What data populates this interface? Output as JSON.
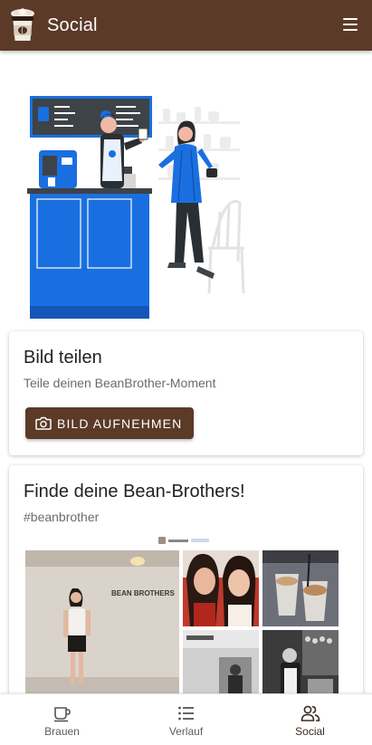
{
  "appbar": {
    "title": "Social",
    "logo_icon": "coffee-cup-logo-icon",
    "menu_icon": "hamburger-menu-icon"
  },
  "share_card": {
    "title": "Bild teilen",
    "subtitle": "Teile deinen BeanBrother-Moment",
    "button_label": "BILD AUFNEHMEN",
    "button_icon": "camera-icon"
  },
  "community_card": {
    "title": "Finde deine Bean-Brothers!",
    "hashtag": "#beanbrother",
    "wall_sign": "BEAN BROTHERS"
  },
  "bottom_nav": {
    "items": [
      {
        "label": "Brauen",
        "icon": "coffee-cup-icon",
        "active": false
      },
      {
        "label": "Verlauf",
        "icon": "list-icon",
        "active": false
      },
      {
        "label": "Social",
        "icon": "people-icon",
        "active": true
      }
    ]
  },
  "colors": {
    "primary": "#5b3a27",
    "accent_blue": "#1a6fe0",
    "background": "#ffffff"
  }
}
